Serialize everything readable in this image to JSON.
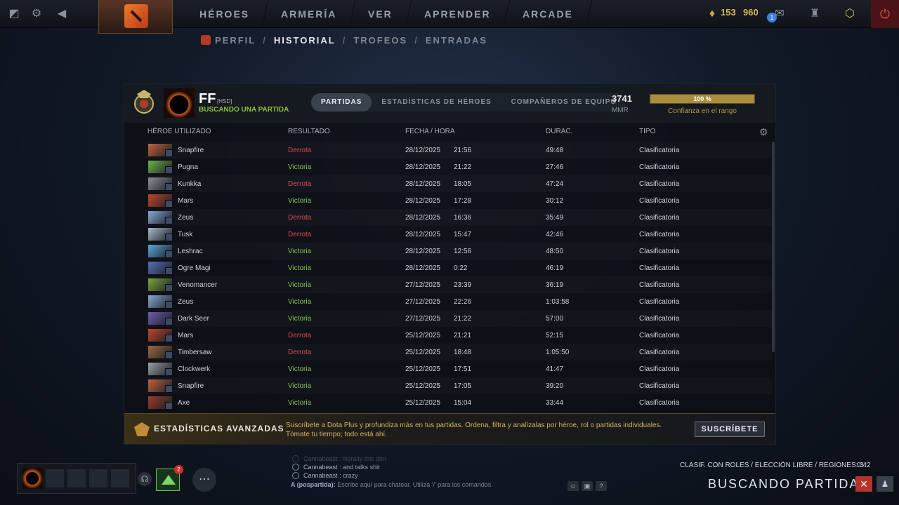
{
  "topbar": {
    "nav": [
      "HÉROES",
      "ARMERÍA",
      "VER",
      "APRENDER",
      "ARCADE"
    ],
    "shards": "153",
    "points": "960",
    "notification_count": "1"
  },
  "subnav": {
    "items": [
      "PERFIL",
      "HISTORIAL",
      "TROFEOS",
      "ENTRADAS"
    ],
    "separator": "/"
  },
  "profile": {
    "name": "FF",
    "tag": "[HSD]",
    "status": "BUSCANDO UNA PARTIDA",
    "tabs": [
      "PARTIDAS",
      "ESTADÍSTICAS DE HÉROES",
      "COMPAÑEROS DE EQUIPO"
    ],
    "mmr_value": "3741",
    "mmr_label": "MMR",
    "confidence_text": "100 %",
    "confidence_value": 1.0,
    "confidence_label": "Confianza en el rango"
  },
  "columns": {
    "hero": "HÉROE UTILIZADO",
    "result": "RESULTADO",
    "date": "FECHA / HORA",
    "duration": "DURAC.",
    "type": "TIPO"
  },
  "matches": [
    {
      "hero": "Snapfire",
      "result": "Derrota",
      "date": "28/12/2025",
      "time": "21:56",
      "duration": "49:48",
      "type": "Clasificatoria",
      "color": "#c0623a"
    },
    {
      "hero": "Pugna",
      "result": "Victoria",
      "date": "28/12/2025",
      "time": "21:22",
      "duration": "27:46",
      "type": "Clasificatoria",
      "color": "#6fb34a"
    },
    {
      "hero": "Kunkka",
      "result": "Derrota",
      "date": "28/12/2025",
      "time": "18:05",
      "duration": "47:24",
      "type": "Clasificatoria",
      "color": "#8a8f96"
    },
    {
      "hero": "Mars",
      "result": "Victoria",
      "date": "28/12/2025",
      "time": "17:28",
      "duration": "30:12",
      "type": "Clasificatoria",
      "color": "#c0452a"
    },
    {
      "hero": "Zeus",
      "result": "Derrota",
      "date": "28/12/2025",
      "time": "16:36",
      "duration": "35:49",
      "type": "Clasificatoria",
      "color": "#8aa9d6"
    },
    {
      "hero": "Tusk",
      "result": "Derrota",
      "date": "28/12/2025",
      "time": "15:47",
      "duration": "42:46",
      "type": "Clasificatoria",
      "color": "#a9b7c6"
    },
    {
      "hero": "Leshrac",
      "result": "Victoria",
      "date": "28/12/2025",
      "time": "12:56",
      "duration": "48:50",
      "type": "Clasificatoria",
      "color": "#5fa6d8"
    },
    {
      "hero": "Ogre Magi",
      "result": "Victoria",
      "date": "28/12/2025",
      "time": "0:22",
      "duration": "46:19",
      "type": "Clasificatoria",
      "color": "#5670b8"
    },
    {
      "hero": "Venomancer",
      "result": "Victoria",
      "date": "27/12/2025",
      "time": "23:39",
      "duration": "36:19",
      "type": "Clasificatoria",
      "color": "#7fa53a"
    },
    {
      "hero": "Zeus",
      "result": "Victoria",
      "date": "27/12/2025",
      "time": "22:26",
      "duration": "1:03:58",
      "type": "Clasificatoria",
      "color": "#8aa9d6"
    },
    {
      "hero": "Dark Seer",
      "result": "Victoria",
      "date": "27/12/2025",
      "time": "21:22",
      "duration": "57:00",
      "type": "Clasificatoria",
      "color": "#6a5fb0"
    },
    {
      "hero": "Mars",
      "result": "Derrota",
      "date": "25/12/2025",
      "time": "21:21",
      "duration": "52:15",
      "type": "Clasificatoria",
      "color": "#c0452a"
    },
    {
      "hero": "Timbersaw",
      "result": "Derrota",
      "date": "25/12/2025",
      "time": "18:48",
      "duration": "1:05:50",
      "type": "Clasificatoria",
      "color": "#9a6a3e"
    },
    {
      "hero": "Clockwerk",
      "result": "Victoria",
      "date": "25/12/2025",
      "time": "17:51",
      "duration": "41:47",
      "type": "Clasificatoria",
      "color": "#9aa0a6"
    },
    {
      "hero": "Snapfire",
      "result": "Victoria",
      "date": "25/12/2025",
      "time": "17:05",
      "duration": "39:20",
      "type": "Clasificatoria",
      "color": "#c0623a"
    },
    {
      "hero": "Axe",
      "result": "Victoria",
      "date": "25/12/2025",
      "time": "15:04",
      "duration": "33:44",
      "type": "Clasificatoria",
      "color": "#9a3a2a"
    }
  ],
  "advanced": {
    "title": "ESTADÍSTICAS AVANZADAS",
    "text": "Suscríbete a Dota Plus y profundiza más en tus partidas. Ordena, filtra y analízalas por héroe, rol o partidas individuales. Tómate tu tiempo; todo está ahí.",
    "button": "SUSCRÍBETE"
  },
  "bottom": {
    "friends_badge": "2",
    "chat_lines": [
      {
        "name": "Cannabeast",
        "text": ": literally this dim"
      },
      {
        "name": "Cannabeast",
        "text": ": and talks shit"
      },
      {
        "name": "Cannabeast",
        "text": ": crazy"
      }
    ],
    "chat_label": "A (pospartida):",
    "chat_placeholder": "Escribe aquí para chatear. Utiliza '/' para los comandos.",
    "queue_info": "CLASIF. CON ROLES / ELECCIÓN LIBRE / REGIONES: 3",
    "queue_time": "0:42",
    "finding_text": "BUSCANDO PARTIDA"
  }
}
